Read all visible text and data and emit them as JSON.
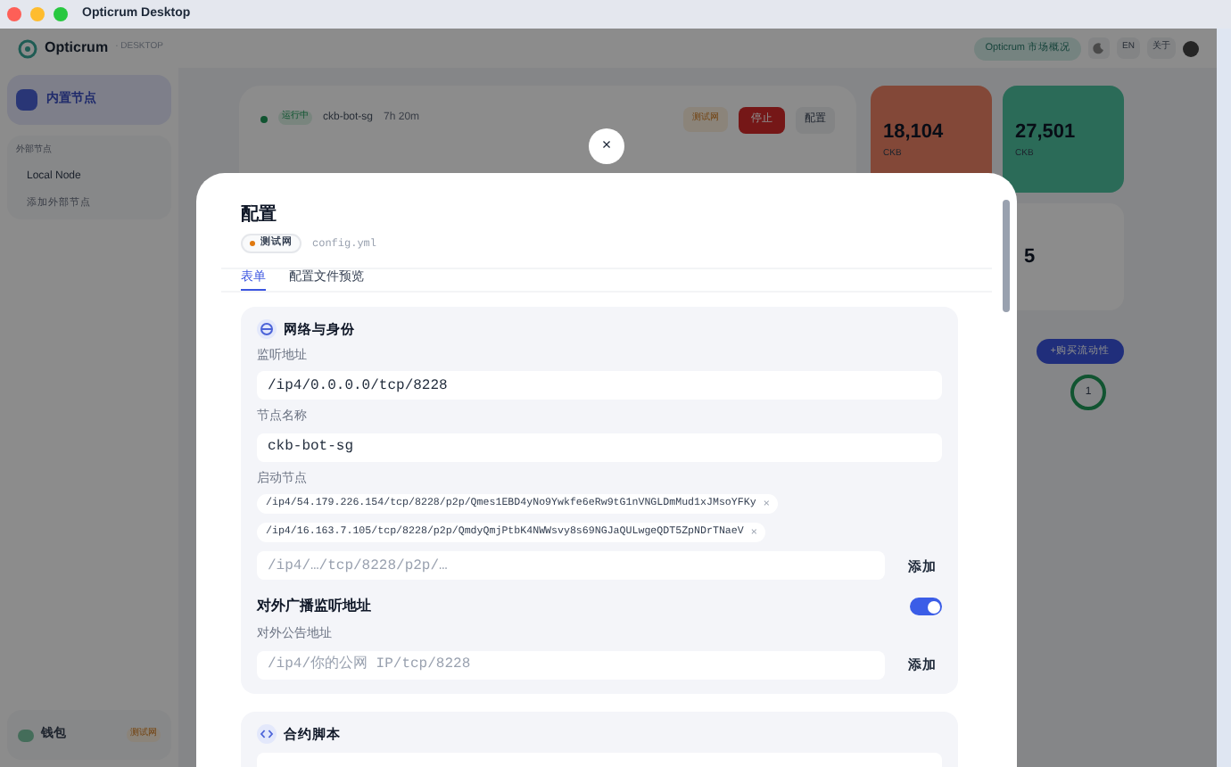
{
  "window": {
    "title": "Opticrum Desktop"
  },
  "header": {
    "brand": "Opticrum",
    "brand_suffix": "· DESKTOP",
    "market_button": "Opticrum 市场概况",
    "language": "EN",
    "about": "关于"
  },
  "sidebar": {
    "items": [
      {
        "label": "内置节点",
        "selected": true
      }
    ],
    "section_label": "外部节点",
    "external_nodes": [
      {
        "label": "Local Node"
      }
    ],
    "add_external": "添加外部节点",
    "wallet": {
      "label": "钱包",
      "network": "测试网"
    }
  },
  "node_card": {
    "status": "运行中",
    "name": "ckb-bot-sg",
    "uptime": "7h 20m",
    "network": "测试网",
    "stop_button": "停止",
    "config_button": "配置"
  },
  "stats": [
    {
      "kind": "outflow",
      "value": "18,104",
      "unit": "CKB"
    },
    {
      "kind": "inflow",
      "value": "27,501",
      "unit": "CKB"
    },
    {
      "kind": "plain",
      "value": "5"
    }
  ],
  "liquidity_button": "+购买流动性",
  "ring_value": "1",
  "dialog": {
    "close": "×",
    "title": "配置",
    "network": "测试网",
    "file": "config.yml",
    "tabs": [
      {
        "label": "表单",
        "selected": true
      },
      {
        "label": "配置文件预览",
        "selected": false
      }
    ],
    "sections": [
      {
        "kind": "network",
        "title": "网络与身份",
        "fields": [
          {
            "kind": "text",
            "label": "监听地址",
            "value": "/ip4/0.0.0.0/tcp/8228"
          },
          {
            "kind": "text",
            "label": "节点名称",
            "value": "ckb-bot-sg"
          },
          {
            "kind": "chips",
            "label": "启动节点",
            "chips": [
              "/ip4/54.179.226.154/tcp/8228/p2p/Qmes1EBD4yNo9Ywkfe6eRw9tG1nVNGLDmMud1xJMsoYFKy",
              "/ip4/16.163.7.105/tcp/8228/p2p/QmdyQmjPtbK4NWWsvy8s69NGJaQULwgeQDT5ZpNDrTNaeV"
            ],
            "remove": "×",
            "placeholder": "/ip4/…/tcp/8228/p2p/…",
            "add_button": "添加"
          },
          {
            "kind": "toggle",
            "label": "对外广播监听地址",
            "on": true
          },
          {
            "kind": "add",
            "label": "对外公告地址",
            "placeholder": "/ip4/你的公网 IP/tcp/8228",
            "add_button": "添加"
          }
        ]
      },
      {
        "kind": "code",
        "title": "合约脚本",
        "fields": [
          {
            "kind": "blank"
          }
        ]
      }
    ]
  }
}
